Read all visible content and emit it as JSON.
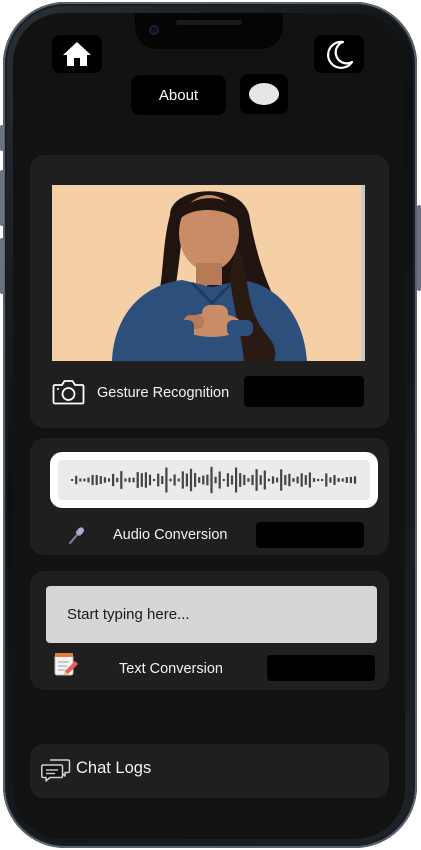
{
  "header": {
    "about_label": "About",
    "home_icon": "home-icon",
    "theme_icon": "moon-icon"
  },
  "gesture": {
    "label": "Gesture Recognition",
    "icon": "camera-icon",
    "photo_alt": "person-signing-photo",
    "output_value": ""
  },
  "audio": {
    "label": "Audio Conversion",
    "icon": "microphone-icon",
    "output_value": ""
  },
  "text": {
    "placeholder": "Start typing here...",
    "label": "Text Conversion",
    "icon": "notepad-pencil-icon",
    "output_value": ""
  },
  "chat": {
    "label": "Chat Logs",
    "icon": "chat-bubbles-icon"
  },
  "colors": {
    "screen_bg": "#121212",
    "card_bg": "#1f1f1f",
    "button_bg": "#000000",
    "text_primary": "#f2f2f2",
    "video_bg": "#f5d0a6",
    "shirt_blue": "#2c4f7c"
  }
}
